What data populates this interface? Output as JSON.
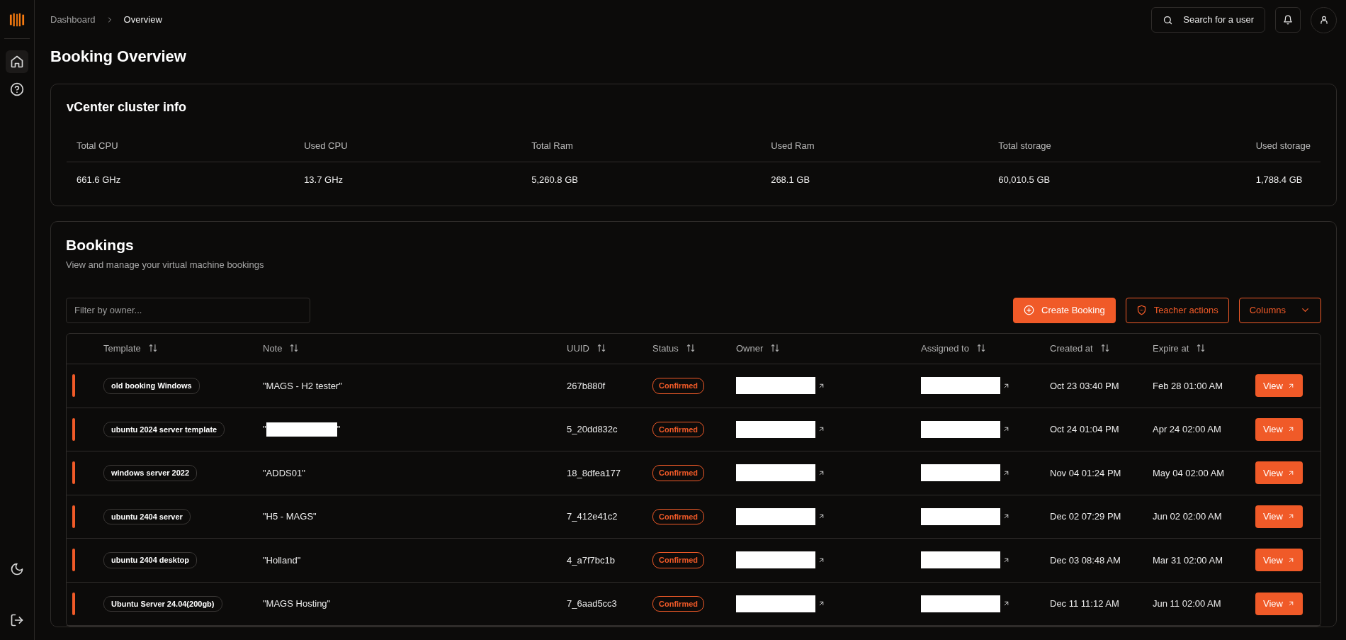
{
  "sidebar": {
    "items": [
      {
        "kind": "home",
        "selected": true
      },
      {
        "kind": "help",
        "selected": false
      }
    ],
    "bottom": [
      {
        "kind": "theme"
      },
      {
        "kind": "logout"
      }
    ]
  },
  "breadcrumb": [
    "Dashboard",
    "Overview"
  ],
  "header": {
    "search_label": "Search for a user"
  },
  "page_title": "Booking Overview",
  "cluster": {
    "title": "vCenter cluster info",
    "columns": [
      "Total CPU",
      "Used CPU",
      "Total Ram",
      "Used Ram",
      "Total storage",
      "Used storage"
    ],
    "values": [
      "661.6 GHz",
      "13.7 GHz",
      "5,260.8 GB",
      "268.1 GB",
      "60,010.5 GB",
      "1,788.4 GB"
    ]
  },
  "bookings": {
    "title": "Bookings",
    "subtitle": "View and manage your virtual machine bookings",
    "filter": {
      "placeholder": "Filter by owner..."
    },
    "buttons": [
      {
        "kind": "create",
        "label": "Create Booking"
      },
      {
        "kind": "teacher",
        "label": "Teacher actions"
      },
      {
        "kind": "columns",
        "label": "Columns"
      }
    ],
    "table": {
      "columns": [
        "Template",
        "Note",
        "UUID",
        "Status",
        "Owner",
        "Assigned to",
        "Created at",
        "Expire at"
      ],
      "rows": [
        {
          "template": "old booking Windows",
          "note": {
            "text": "\"MAGS - H2 tester\""
          },
          "uuid": "267b880f",
          "status": "Confirmed",
          "owner": {
            "redacted": true
          },
          "assigned_to": {
            "redacted": true
          },
          "created_at": "Oct 23 03:40 PM",
          "expire_at": "Feb 28 01:00 AM",
          "action": "View"
        },
        {
          "template": "ubuntu 2024 server template",
          "note": {
            "prefix": "\"",
            "redacted": true,
            "suffix": "\""
          },
          "uuid": "5_20dd832c",
          "status": "Confirmed",
          "owner": {
            "redacted": true
          },
          "assigned_to": {
            "redacted": true
          },
          "created_at": "Oct 24 01:04 PM",
          "expire_at": "Apr 24 02:00 AM",
          "action": "View"
        },
        {
          "template": "windows server 2022",
          "note": {
            "text": "\"ADDS01\""
          },
          "uuid": "18_8dfea177",
          "status": "Confirmed",
          "owner": {
            "redacted": true
          },
          "assigned_to": {
            "redacted": true
          },
          "created_at": "Nov 04 01:24 PM",
          "expire_at": "May 04 02:00 AM",
          "action": "View"
        },
        {
          "template": "ubuntu 2404 server",
          "note": {
            "text": "\"H5 - MAGS\""
          },
          "uuid": "7_412e41c2",
          "status": "Confirmed",
          "owner": {
            "redacted": true
          },
          "assigned_to": {
            "redacted": true
          },
          "created_at": "Dec 02 07:29 PM",
          "expire_at": "Jun 02 02:00 AM",
          "action": "View"
        },
        {
          "template": "ubuntu 2404 desktop",
          "note": {
            "text": "\"Holland\""
          },
          "uuid": "4_a7f7bc1b",
          "status": "Confirmed",
          "owner": {
            "redacted": true
          },
          "assigned_to": {
            "redacted": true
          },
          "created_at": "Dec 03 08:48 AM",
          "expire_at": "Mar 31 02:00 AM",
          "action": "View"
        },
        {
          "template": "Ubuntu Server 24.04(200gb)",
          "note": {
            "text": "\"MAGS Hosting\""
          },
          "uuid": "7_6aad5cc3",
          "status": "Confirmed",
          "owner": {
            "redacted": true
          },
          "assigned_to": {
            "redacted": true
          },
          "created_at": "Dec 11 11:12 AM",
          "expire_at": "Jun 11 02:00 AM",
          "action": "View"
        }
      ]
    }
  }
}
